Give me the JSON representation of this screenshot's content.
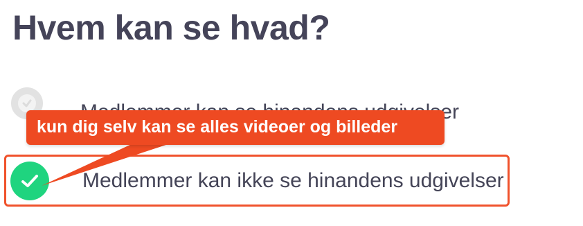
{
  "page": {
    "title": "Hvem kan se hvad?"
  },
  "options": [
    {
      "label": "Medlemmer kan se hinandens udgivelser",
      "selected": false,
      "icon": "radio-unchecked-icon"
    },
    {
      "label": "Medlemmer kan ikke se hinandens udgivelser",
      "selected": true,
      "icon": "check-icon"
    }
  ],
  "annotation": {
    "text": "kun dig selv kan se alles videoer og billeder",
    "color": "#ee4a22"
  },
  "colors": {
    "title": "#454459",
    "text": "#444457",
    "selected_green": "#1fd47f",
    "unselected_gray": "#e2e2e2",
    "highlight_border": "#f0522c"
  }
}
